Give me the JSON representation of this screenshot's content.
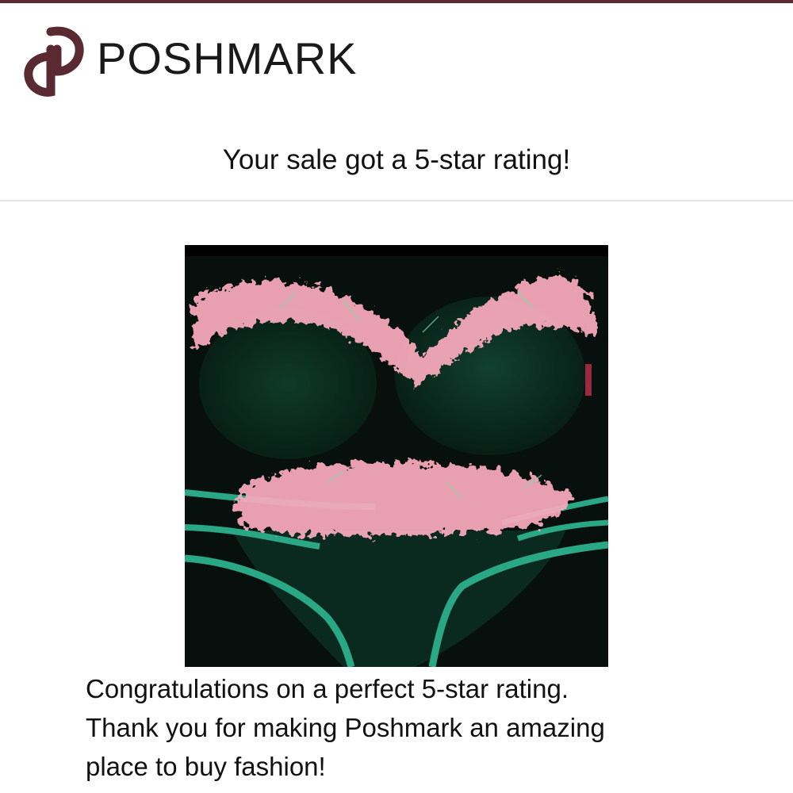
{
  "brand": {
    "name": "POSHMARK",
    "logo_icon": "poshmark-p-logo",
    "logo_color": "#5a2a33"
  },
  "notification": {
    "headline": "Your sale got a 5-star rating!"
  },
  "product_image": {
    "alt": "Pink feather trimmed green bikini",
    "icon": "product-photo"
  },
  "message": {
    "lines": [
      "Congratulations on a perfect 5-star rating.",
      "Thank you for making Poshmark an amazing",
      "place to buy fashion!"
    ]
  },
  "colors": {
    "accent": "#5a2a33",
    "divider": "#e2e2e2",
    "text": "#111111"
  }
}
